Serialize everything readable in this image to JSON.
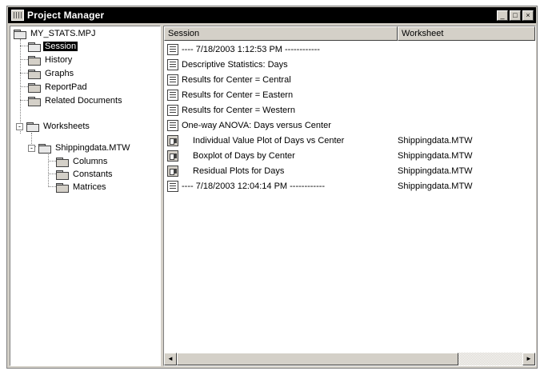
{
  "window": {
    "title": "Project Manager",
    "controls": [
      "_",
      "□",
      "×"
    ]
  },
  "tree": {
    "root": "MY_STATS.MPJ",
    "items": [
      {
        "label": "Session",
        "selected": true
      },
      {
        "label": "History"
      },
      {
        "label": "Graphs"
      },
      {
        "label": "ReportPad"
      },
      {
        "label": "Related Documents"
      },
      {
        "label": "Worksheets",
        "expander": "-"
      },
      {
        "label": "Shippingdata.MTW",
        "expander": "-"
      },
      {
        "label": "Columns"
      },
      {
        "label": "Constants"
      },
      {
        "label": "Matrices"
      }
    ]
  },
  "list": {
    "columns": [
      "Session",
      "Worksheet"
    ],
    "rows": [
      {
        "text": "---- 7/18/2003 1:12:53 PM ------------",
        "worksheet": "",
        "icon": "session-icon"
      },
      {
        "text": "Descriptive Statistics: Days",
        "worksheet": "",
        "icon": "session-icon"
      },
      {
        "text": "Results for Center = Central",
        "worksheet": "",
        "icon": "session-icon"
      },
      {
        "text": "Results for Center = Eastern",
        "worksheet": "",
        "icon": "session-icon"
      },
      {
        "text": "Results for Center = Western",
        "worksheet": "",
        "icon": "session-icon"
      },
      {
        "text": "One-way ANOVA: Days versus Center",
        "worksheet": "",
        "icon": "session-icon"
      },
      {
        "text": "Individual Value Plot of Days vs Center",
        "worksheet": "Shippingdata.MTW",
        "icon": "graph-icon"
      },
      {
        "text": "Boxplot of Days by Center",
        "worksheet": "Shippingdata.MTW",
        "icon": "graph-icon"
      },
      {
        "text": "Residual Plots for Days",
        "worksheet": "Shippingdata.MTW",
        "icon": "graph-icon"
      },
      {
        "text": "---- 7/18/2003 12:04:14 PM ------------",
        "worksheet": "Shippingdata.MTW",
        "icon": "session-icon"
      }
    ]
  },
  "scrollbar": {
    "left_arrow": "◄",
    "right_arrow": "►"
  }
}
